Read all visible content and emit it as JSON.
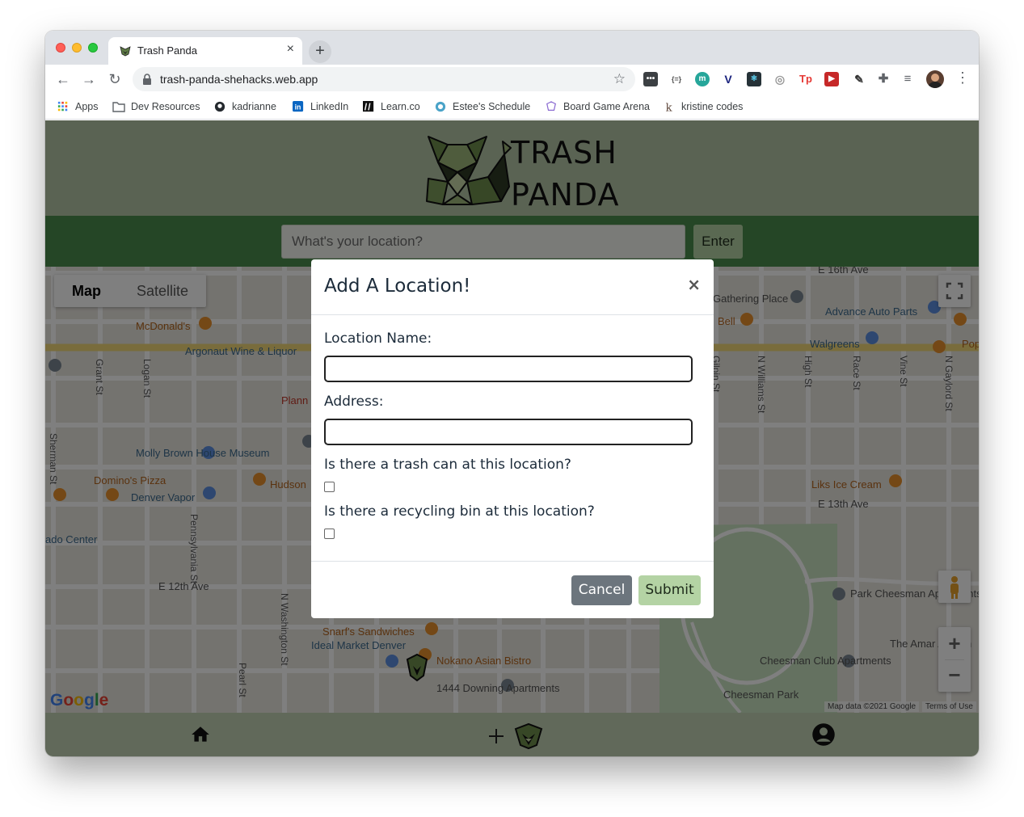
{
  "browser": {
    "tab_title": "Trash Panda",
    "url": "trash-panda-shehacks.web.app",
    "bookmarks": [
      "Apps",
      "Dev Resources",
      "kadrianne",
      "LinkedIn",
      "Learn.co",
      "Estee's Schedule",
      "Board Game Arena",
      "kristine codes"
    ]
  },
  "header": {
    "logo_line1": "TRASH",
    "logo_line2": "PANDA"
  },
  "search": {
    "placeholder": "What's your location?",
    "enter_label": "Enter"
  },
  "map": {
    "type_map": "Map",
    "type_satellite": "Satellite",
    "labels": [
      "McDonald's",
      "Argonaut Wine & Liquor",
      "Molly Brown House Museum",
      "Domino's Pizza",
      "Denver Vapor",
      "Hudson",
      "Snarf's Sandwiches",
      "Ideal Market Denver",
      "Nokano Asian Bistro",
      "1444 Downing Apartments",
      "Gathering Place",
      "Advance Auto Parts",
      "Walgreens",
      "Liks Ice Cream",
      "Park Cheesman Apartments",
      "The Amar Apartm",
      "Cheesman Club Apartments",
      "Cheesman Park",
      "E 12th Ave",
      "E 13th Ave",
      "E 16th Ave",
      "Grant St",
      "Logan St",
      "Pennsylvania St",
      "Pearl St",
      "N Washington St",
      "High St",
      "Race St",
      "Vine St",
      "N Gaylord St",
      "N Williams St",
      "Gilpin St",
      "Sherman St",
      "ado Center",
      "Bell",
      "Popey Louis",
      "Plann - D"
    ],
    "map_data": "Map data ©2021 Google",
    "terms": "Terms of Use",
    "google": "Google"
  },
  "modal": {
    "title": "Add A Location!",
    "close": "×",
    "name_label": "Location Name:",
    "name_value": "",
    "address_label": "Address:",
    "address_value": "",
    "trash_label": "Is there a trash can at this location?",
    "recycle_label": "Is there a recycling bin at this location?",
    "cancel": "Cancel",
    "submit": "Submit"
  },
  "colors": {
    "header_green": "#b4c6a6",
    "search_green": "#4a8c4c",
    "button_green": "#b4d3a4",
    "cancel_gray": "#6c757d"
  },
  "icons": [
    "home-icon",
    "plus-icon",
    "raccoon-icon",
    "account-icon",
    "fullscreen-icon",
    "zoom-in-icon",
    "zoom-out-icon",
    "pegman-icon"
  ]
}
